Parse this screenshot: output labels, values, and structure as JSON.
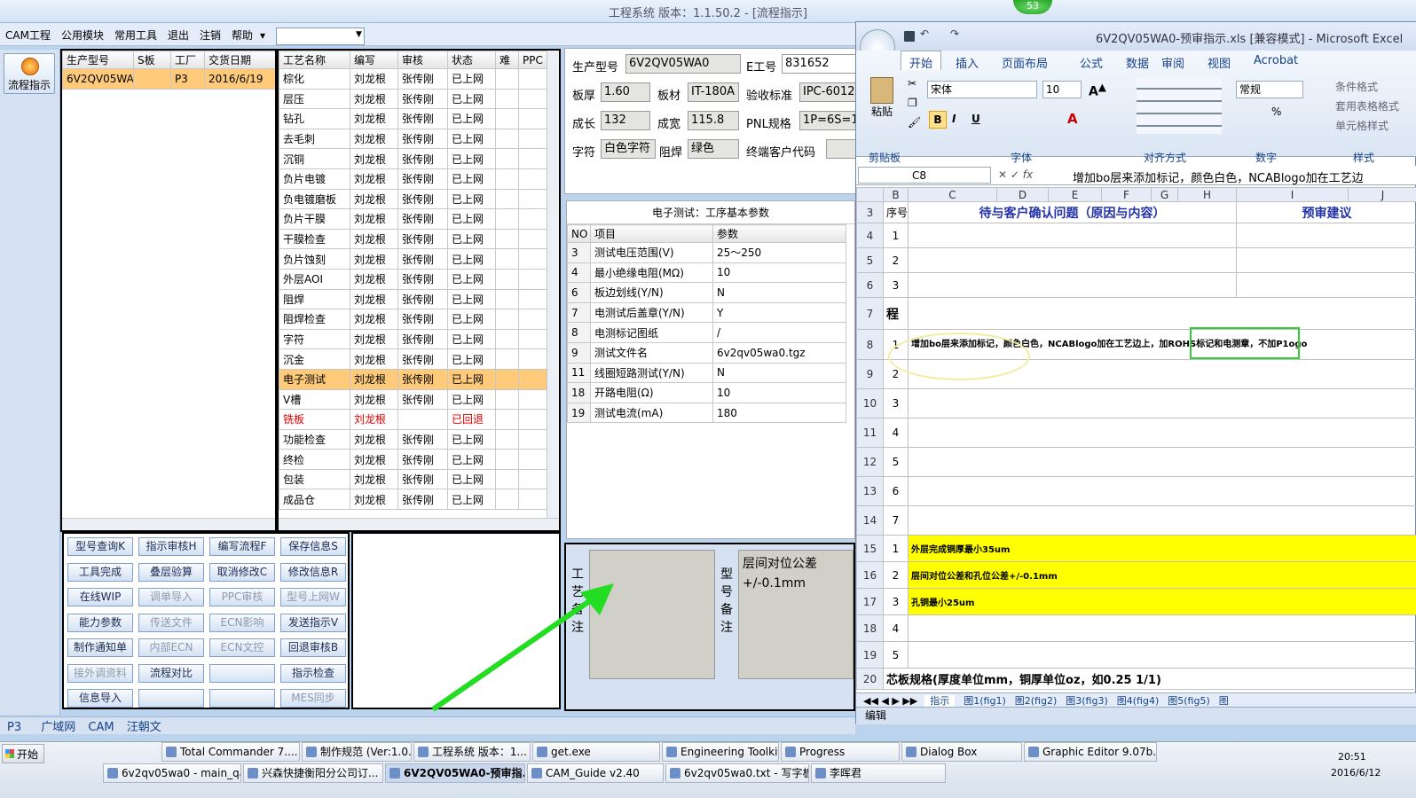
{
  "app": {
    "title": "工程系统  版本：1.1.50.2 - [流程指示]",
    "badge": "53"
  },
  "menu": {
    "items": [
      "CAM工程",
      "公用模块",
      "常用工具",
      "退出",
      "注销",
      "帮助"
    ]
  },
  "left": {
    "flow_label": "流程指示"
  },
  "orders": {
    "headers": [
      "生产型号",
      "S板",
      "工厂",
      "交货日期"
    ],
    "rows": [
      [
        "6V2QV05WA0",
        "",
        "P3",
        "2016/6/19"
      ]
    ]
  },
  "process": {
    "headers": [
      "工艺名称",
      "编写",
      "审核",
      "状态",
      "难",
      "PPC"
    ],
    "rows": [
      [
        "棕化",
        "刘龙根",
        "张传刚",
        "已上网"
      ],
      [
        "层压",
        "刘龙根",
        "张传刚",
        "已上网"
      ],
      [
        "钻孔",
        "刘龙根",
        "张传刚",
        "已上网"
      ],
      [
        "去毛刺",
        "刘龙根",
        "张传刚",
        "已上网"
      ],
      [
        "沉铜",
        "刘龙根",
        "张传刚",
        "已上网"
      ],
      [
        "负片电镀",
        "刘龙根",
        "张传刚",
        "已上网"
      ],
      [
        "负电镀磨板",
        "刘龙根",
        "张传刚",
        "已上网"
      ],
      [
        "负片干膜",
        "刘龙根",
        "张传刚",
        "已上网"
      ],
      [
        "干膜检查",
        "刘龙根",
        "张传刚",
        "已上网"
      ],
      [
        "负片蚀刻",
        "刘龙根",
        "张传刚",
        "已上网"
      ],
      [
        "外层AOI",
        "刘龙根",
        "张传刚",
        "已上网"
      ],
      [
        "阻焊",
        "刘龙根",
        "张传刚",
        "已上网"
      ],
      [
        "阻焊检查",
        "刘龙根",
        "张传刚",
        "已上网"
      ],
      [
        "字符",
        "刘龙根",
        "张传刚",
        "已上网"
      ],
      [
        "沉金",
        "刘龙根",
        "张传刚",
        "已上网"
      ],
      [
        "电子测试",
        "刘龙根",
        "张传刚",
        "已上网"
      ],
      [
        "V槽",
        "刘龙根",
        "张传刚",
        "已上网"
      ],
      [
        "铣板",
        "刘龙根",
        "",
        "已回退"
      ],
      [
        "功能检查",
        "刘龙根",
        "张传刚",
        "已上网"
      ],
      [
        "终检",
        "刘龙根",
        "张传刚",
        "已上网"
      ],
      [
        "包装",
        "刘龙根",
        "张传刚",
        "已上网"
      ],
      [
        "成品仓",
        "刘龙根",
        "张传刚",
        "已上网"
      ]
    ]
  },
  "buttons": [
    [
      "型号查询K",
      "指示审核H",
      "编写流程F",
      "保存信息S"
    ],
    [
      "工具完成",
      "叠层验算",
      "取消修改C",
      "修改信息R"
    ],
    [
      "在线WIP",
      "调单导入",
      "PPC审核",
      "型号上网W"
    ],
    [
      "能力参数",
      "传送文件",
      "ECN影响",
      "发送指示V"
    ],
    [
      "制作通知单",
      "内部ECN",
      "ECN文控",
      "回退审核B"
    ],
    [
      "接外调资料",
      "流程对比",
      "",
      "指示检查"
    ],
    [
      "信息导入",
      "",
      "",
      "MES同步"
    ]
  ],
  "info": {
    "model_label": "生产型号",
    "model": "6V2QV05WA0",
    "e_label": "E工号",
    "e_no": "831652",
    "thick_label": "板厚",
    "thick": "1.60",
    "mat_label": "板材",
    "mat": "IT-180A",
    "std_label": "验收标准",
    "std": "IPC-6012",
    "len_label": "成长",
    "len": "132",
    "wid_label": "成宽",
    "wid": "115.8",
    "pnl_label": "PNL规格",
    "pnl": "1P=6S=1",
    "char_label": "字符",
    "char": "白色字符",
    "sm_label": "阻焊",
    "sm": "绿色",
    "cust_label": "终端客户代码"
  },
  "params": {
    "title": "电子测试：工序基本参数",
    "headers": [
      "NO",
      "项目",
      "参数"
    ],
    "rows": [
      [
        "3",
        "测试电压范围(V)",
        "25～250"
      ],
      [
        "4",
        "最小绝缘电阻(MΩ)",
        "10"
      ],
      [
        "6",
        "板边划线(Y/N)",
        "N"
      ],
      [
        "7",
        "电测试后盖章(Y/N)",
        "Y"
      ],
      [
        "8",
        "电测标记图纸",
        "/"
      ],
      [
        "9",
        "测试文件名",
        "6v2qv05wa0.tgz"
      ],
      [
        "11",
        "线圈短路测试(Y/N)",
        "N"
      ],
      [
        "18",
        "开路电阻(Ω)",
        "10"
      ],
      [
        "19",
        "测试电流(mA)",
        "180"
      ]
    ]
  },
  "remarks": {
    "proc_label": "工艺备注",
    "model_label": "型号备注",
    "model_text": "层间对位公差+/-0.1mm"
  },
  "status_tabs": [
    "P3",
    "广域网",
    "CAM",
    "汪朝文"
  ],
  "excel": {
    "title": "6V2QV05WA0-预审指示.xls  [兼容模式] - Microsoft Excel",
    "tabs": [
      "开始",
      "插入",
      "页面布局",
      "公式",
      "数据",
      "审阅",
      "视图",
      "Acrobat"
    ],
    "font": "宋体",
    "size": "10",
    "numfmt": "常规",
    "paste": "粘贴",
    "groups": [
      "剪贴板",
      "字体",
      "对齐方式",
      "数字",
      "样式"
    ],
    "styles": [
      "条件格式",
      "套用表格格式",
      "单元格样式"
    ],
    "cellref": "C8",
    "formula": "增加bo层来添加标记，颜色白色，NCABlogo加在工艺边",
    "cols": [
      "B",
      "C",
      "D",
      "E",
      "F",
      "G",
      "H",
      "I",
      "J"
    ],
    "hdr_seq": "序号",
    "hdr_q": "待与客户确认问题（原因与内容）",
    "hdr_s": "预审建议",
    "row7": "程",
    "row8": "增加bo层来添加标记，颜色白色，NCABlogo加在工艺边上，加ROHS标记和电测章，不加P1ogo",
    "y1": "外层完成铜厚最小35um",
    "y2": "层间对位公差和孔位公差+/-0.1mm",
    "y3": "孔铜最小25um",
    "row20": "芯板规格(厚度单位mm，铜厚单位oz，如0.25 1/1)",
    "sheets": [
      "指示",
      "图1(fig1)",
      "图2(fig2)",
      "图3(fig3)",
      "图4(fig4)",
      "图5(fig5)",
      "图"
    ],
    "status": "编辑"
  },
  "taskbar": {
    "start": "开始",
    "clock": "20:51",
    "date": "2016/6/12",
    "row1": [
      "Total Commander 7....",
      "制作规范 (Ver:1.0.6)",
      "工程系统  版本：1...",
      "get.exe",
      "Engineering Toolkit 9...",
      "Progress",
      "Dialog Box",
      "Graphic Editor 9.07b..."
    ],
    "row2": [
      "6v2qv05wa0 - main_qa",
      "兴森快捷衡阳分公司订...",
      "6V2QV05WA0-预审指...",
      "CAM_Guide v2.40",
      "6v2qv05wa0.txt - 写字板",
      "李晖君"
    ]
  },
  "colors": {
    "selected_row": "#ffcb7a",
    "arrow": "#22dd22",
    "highlight_yellow": "#ffff00"
  }
}
